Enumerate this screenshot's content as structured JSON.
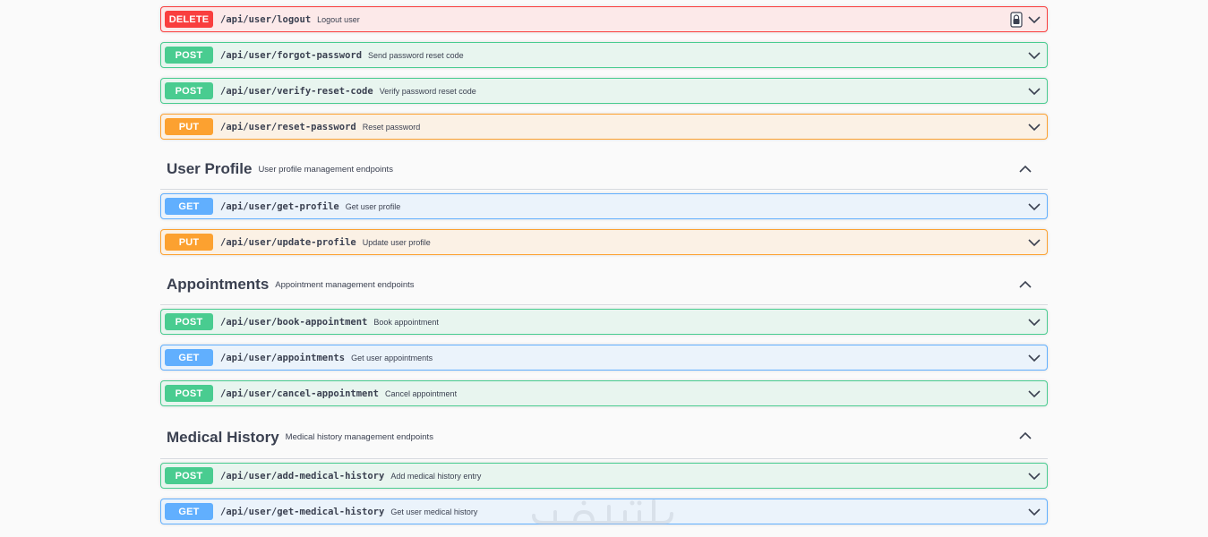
{
  "auth_ops": [
    {
      "method": "DELETE",
      "kind": "delete",
      "path": "/api/user/logout",
      "summary": "Logout user",
      "locked": true
    },
    {
      "method": "POST",
      "kind": "post",
      "path": "/api/user/forgot-password",
      "summary": "Send password reset code"
    },
    {
      "method": "POST",
      "kind": "post",
      "path": "/api/user/verify-reset-code",
      "summary": "Verify password reset code"
    },
    {
      "method": "PUT",
      "kind": "put",
      "path": "/api/user/reset-password",
      "summary": "Reset password"
    }
  ],
  "sections": [
    {
      "name": "User Profile",
      "description": "User profile management endpoints",
      "ops": [
        {
          "method": "GET",
          "kind": "get",
          "path": "/api/user/get-profile",
          "summary": "Get user profile"
        },
        {
          "method": "PUT",
          "kind": "put",
          "path": "/api/user/update-profile",
          "summary": "Update user profile"
        }
      ]
    },
    {
      "name": "Appointments",
      "description": "Appointment management endpoints",
      "ops": [
        {
          "method": "POST",
          "kind": "post",
          "path": "/api/user/book-appointment",
          "summary": "Book appointment"
        },
        {
          "method": "GET",
          "kind": "get",
          "path": "/api/user/appointments",
          "summary": "Get user appointments"
        },
        {
          "method": "POST",
          "kind": "post",
          "path": "/api/user/cancel-appointment",
          "summary": "Cancel appointment"
        }
      ]
    },
    {
      "name": "Medical History",
      "description": "Medical history management endpoints",
      "ops": [
        {
          "method": "POST",
          "kind": "post",
          "path": "/api/user/add-medical-history",
          "summary": "Add medical history entry"
        },
        {
          "method": "GET",
          "kind": "get",
          "path": "/api/user/get-medical-history",
          "summary": "Get user medical history"
        }
      ]
    }
  ],
  "icons": {
    "expand": "chevron-down-icon",
    "collapse": "chevron-up-icon",
    "auth": "lock-icon"
  },
  "watermark": "خمسات",
  "colors": {
    "delete": "#f93e3e",
    "post": "#49cc90",
    "put": "#fca130",
    "get": "#61affe"
  }
}
